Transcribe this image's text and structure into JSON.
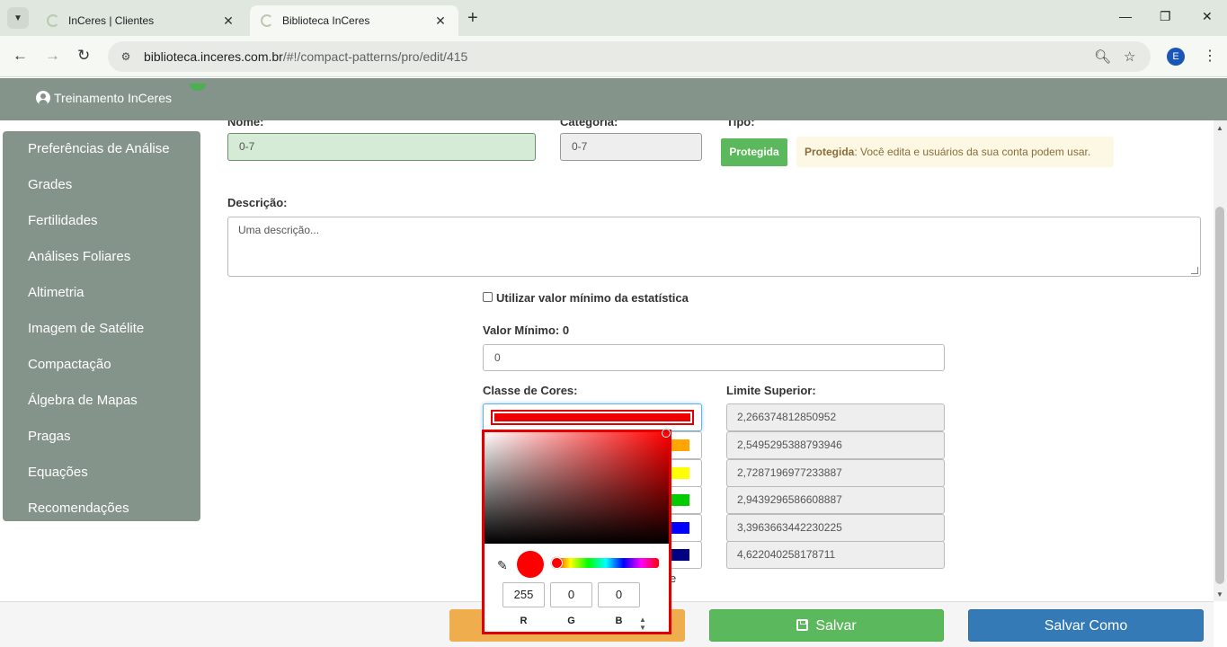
{
  "browser": {
    "tabs": [
      {
        "title": "InCeres | Clientes",
        "active": false
      },
      {
        "title": "Biblioteca InCeres",
        "active": true
      }
    ],
    "url_host": "biblioteca.inceres.com.br",
    "url_path": "/#!/compact-patterns/pro/edit/415",
    "profile_initial": "E"
  },
  "header": {
    "user": "Treinamento InCeres"
  },
  "sidebar": {
    "items": [
      "Preferências de Análise",
      "Grades",
      "Fertilidades",
      "Análises Foliares",
      "Altimetria",
      "Imagem de Satélite",
      "Compactação",
      "Álgebra de Mapas",
      "Pragas",
      "Equações",
      "Recomendações"
    ]
  },
  "form": {
    "nome_label": "Nome:",
    "nome_value": "0-7",
    "categoria_label": "Categoria:",
    "categoria_value": "0-7",
    "tipo_label": "Tipo:",
    "tipo_badge": "Protegida",
    "tipo_note_strong": "Protegida",
    "tipo_note_text": ": Você edita e usuários da sua conta podem usar.",
    "descricao_label": "Descrição:",
    "descricao_placeholder": "Uma descrição...",
    "min_checkbox_label": "Utilizar valor mínimo da estatística",
    "valor_minimo_label": "Valor Mínimo: 0",
    "valor_minimo_value": "0",
    "classe_label": "Classe de Cores:",
    "limite_label": "Limite Superior:",
    "classes": [
      {
        "color": "#ee0000",
        "limit": "2,266374812850952"
      },
      {
        "color": "#ffa500",
        "limit": "2,5495295388793946"
      },
      {
        "color": "#ffff00",
        "limit": "2,7287196977233887"
      },
      {
        "color": "#00cc00",
        "limit": "2,9439296586608887"
      },
      {
        "color": "#0000ff",
        "limit": "3,3963663442230225"
      },
      {
        "color": "#000080",
        "limit": "4,622040258178711"
      }
    ],
    "partial_text": "e"
  },
  "color_picker": {
    "r": "255",
    "g": "0",
    "b": "0",
    "r_label": "R",
    "g_label": "G",
    "b_label": "B",
    "selected_color": "#ff0000"
  },
  "footer": {
    "save_label": "Salvar",
    "save_as_label": "Salvar Como"
  }
}
